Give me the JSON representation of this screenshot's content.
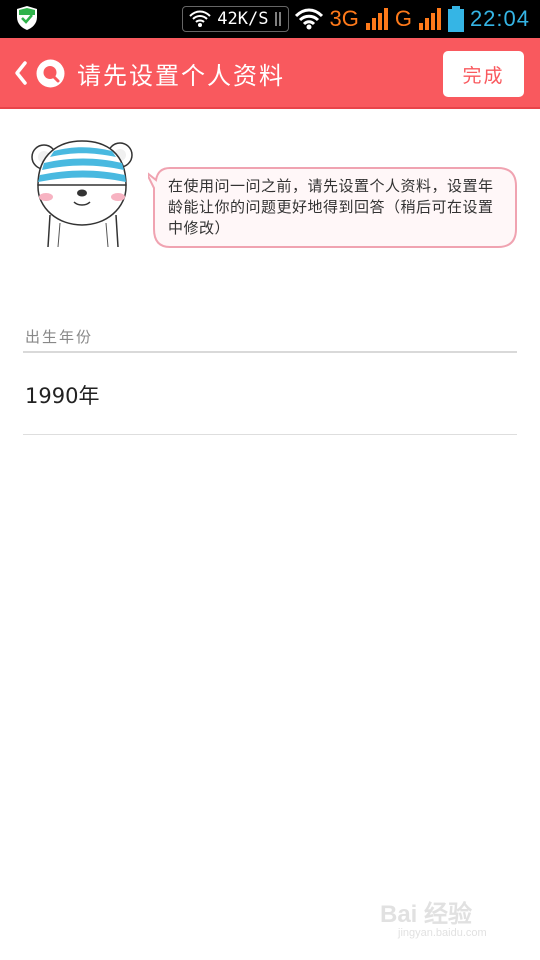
{
  "status_bar": {
    "net_speed": "42K/S",
    "network_1": "3G",
    "sim_1": "1",
    "network_2": "G",
    "sim_2": "2",
    "time": "22:04",
    "icons": [
      "shield-icon",
      "wifi-icon",
      "signal-icon",
      "battery-icon"
    ]
  },
  "header": {
    "title": "请先设置个人资料",
    "done_label": "完成",
    "background_color": "#f9595e"
  },
  "intro": {
    "bubble_text": "在使用问一问之前，请先设置个人资料，设置年龄能让你的问题更好地得到回答（稍后可在设置中修改）"
  },
  "form": {
    "birth_year_label": "出生年份",
    "birth_year_value": "1990年"
  },
  "watermark": {
    "main": "Bai 经验",
    "sub": "jingyan.baidu.com"
  }
}
